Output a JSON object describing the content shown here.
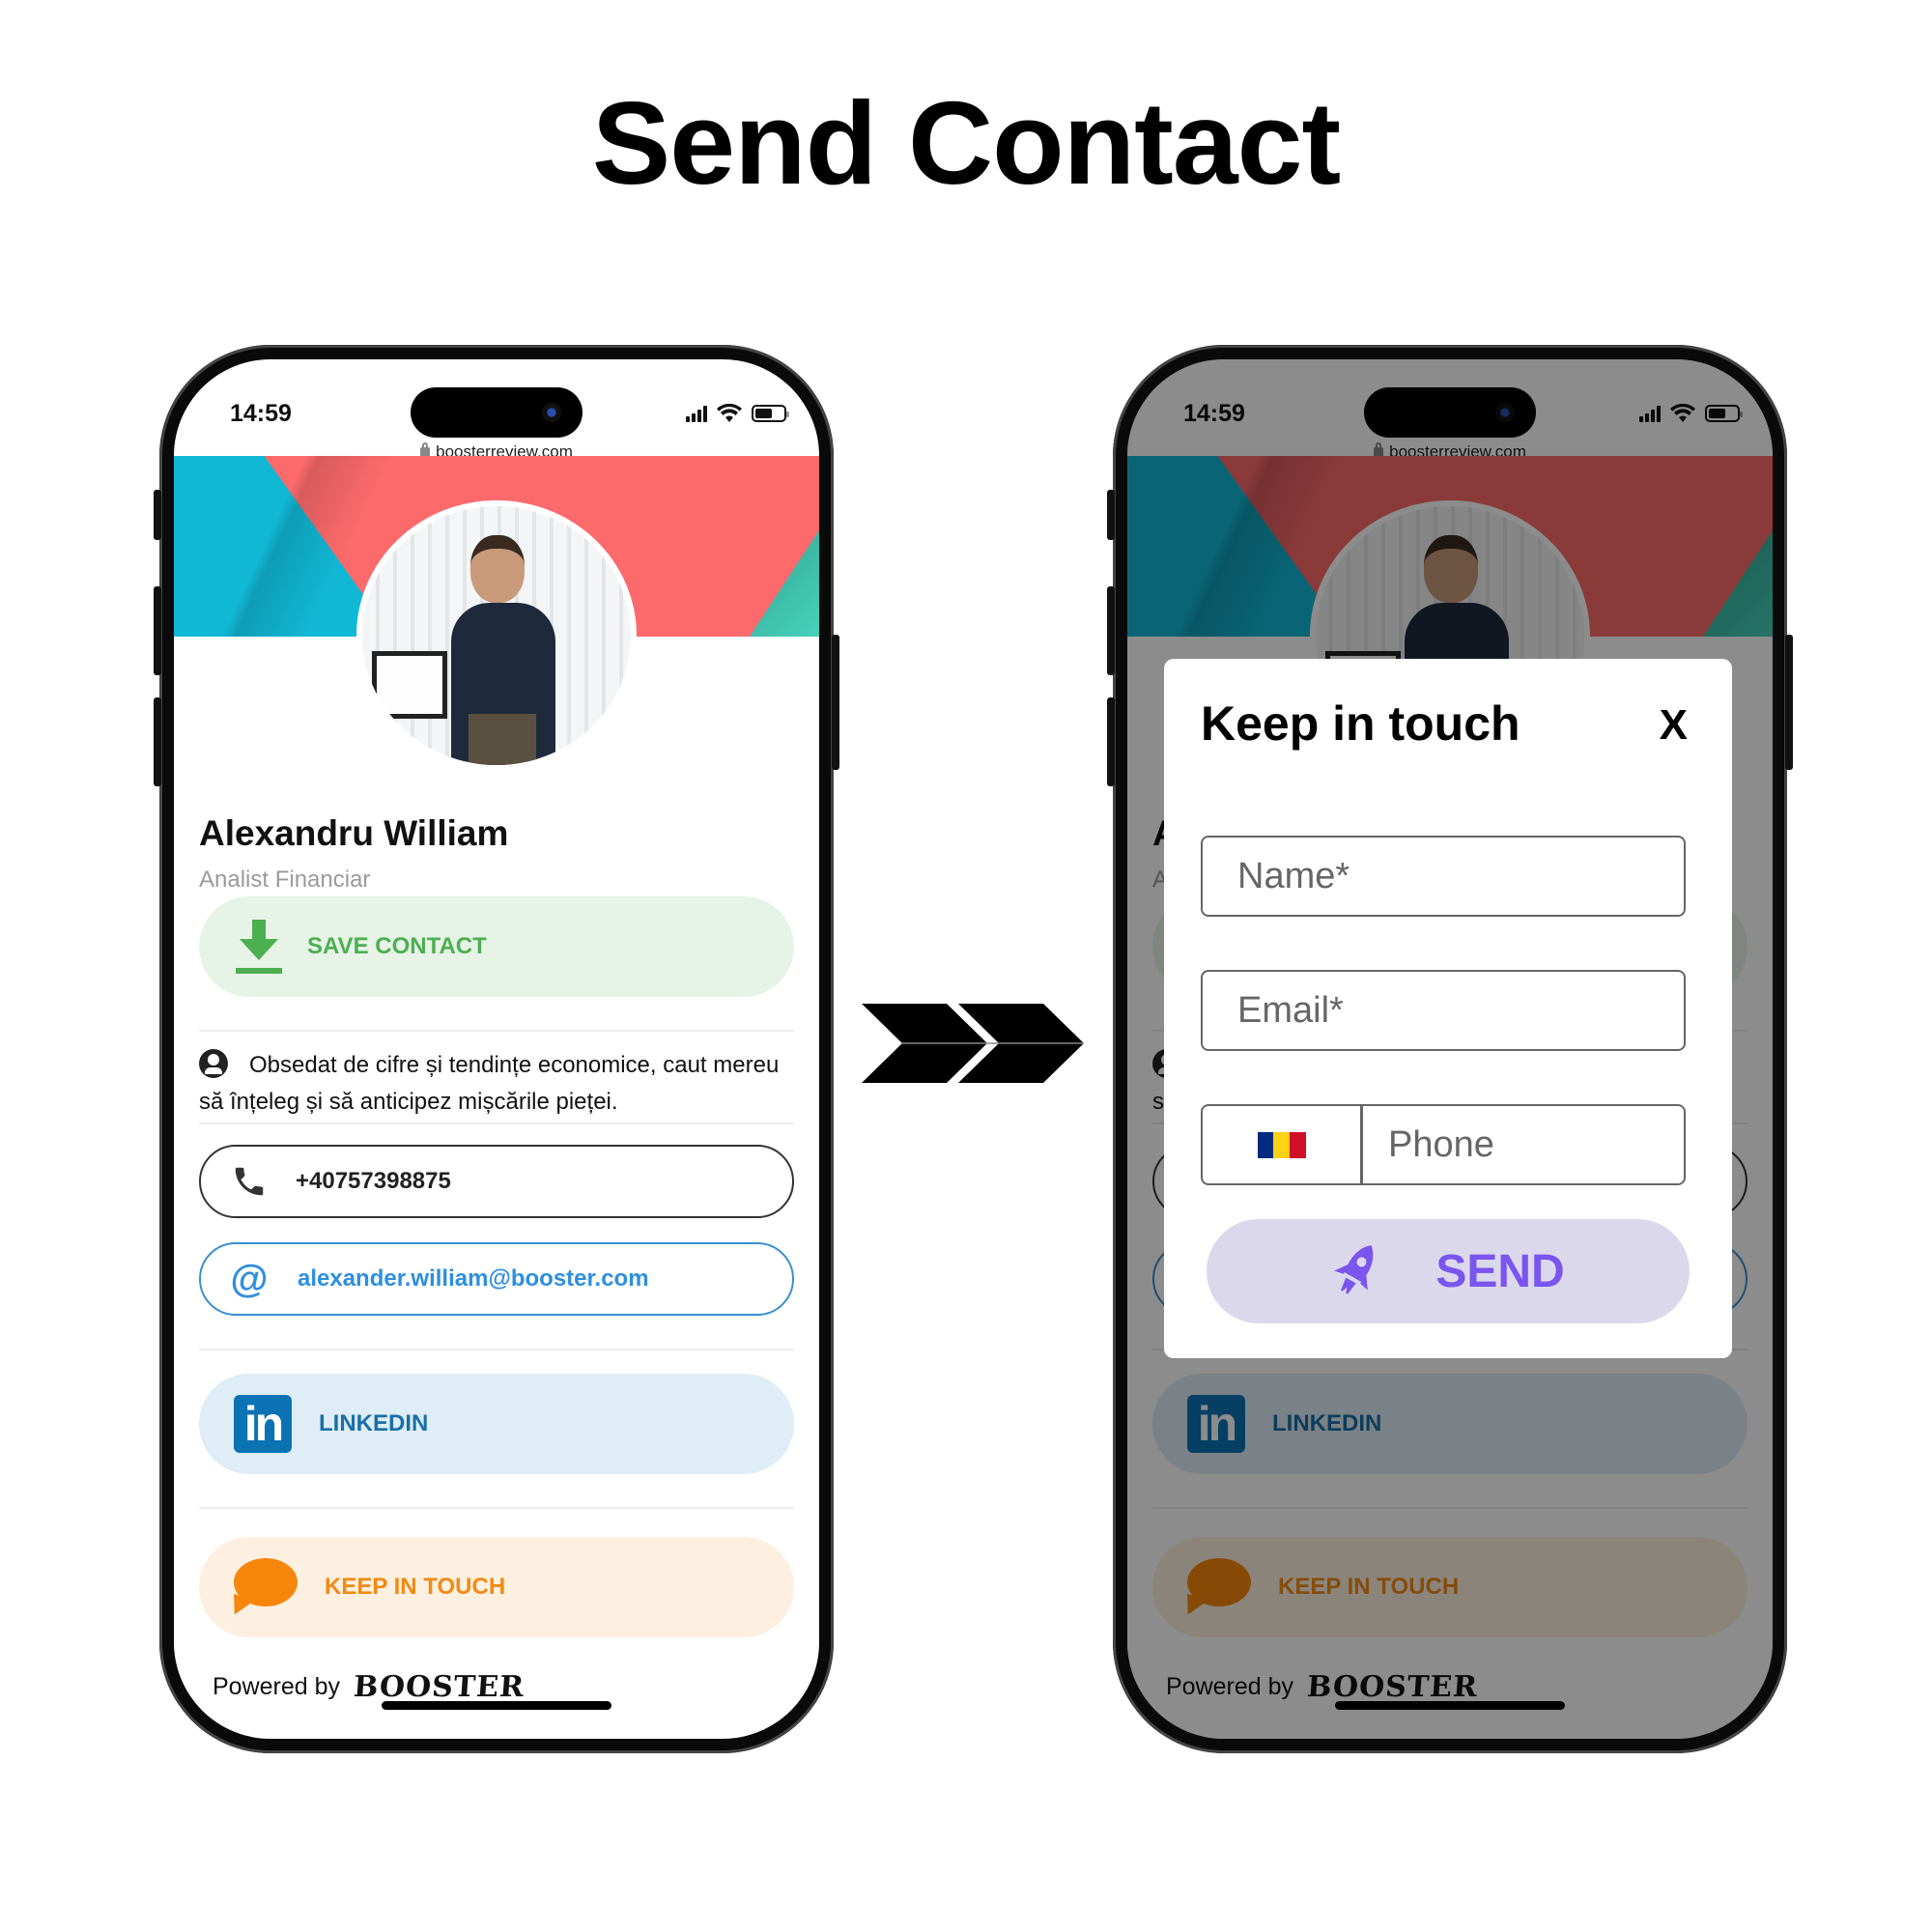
{
  "page": {
    "title": "Send Contact"
  },
  "status_bar": {
    "time": "14:59",
    "url": "boosterreview.com"
  },
  "profile": {
    "name": "Alexandru William",
    "role": "Analist Financiar",
    "bio": "Obsedat de cifre și tendințe economice, caut mereu să înțeleg și să anticipez mișcările pieței.",
    "buttons": {
      "save_contact": "SAVE CONTACT",
      "phone": "+40757398875",
      "email": "alexander.william@booster.com",
      "linkedin": "LINKEDIN",
      "keep_in_touch": "KEEP IN TOUCH"
    },
    "footer": {
      "powered_by": "Powered by",
      "brand": "BOOSTER"
    }
  },
  "modal": {
    "title": "Keep in touch",
    "close_label": "X",
    "name_placeholder": "Name*",
    "email_placeholder": "Email*",
    "phone_placeholder": "Phone",
    "country_flag": "romania-flag-icon",
    "send_label": "SEND"
  },
  "icons": {
    "save": "download-icon",
    "bio": "user-circle-icon",
    "phone": "phone-icon",
    "email": "at-sign-icon",
    "linkedin": "linkedin-icon",
    "keep_in_touch": "chat-bubble-icon",
    "send": "rocket-icon",
    "transition": "double-chevron-right-icon"
  },
  "colors": {
    "save_green": "#4caf50",
    "email_blue": "#2d8fde",
    "linkedin_blue": "#0b73b4",
    "keep_orange": "#f6870c",
    "send_purple": "#7a55ee",
    "banner_cyan": "#11b8d6",
    "banner_red": "#fd6a6b"
  }
}
